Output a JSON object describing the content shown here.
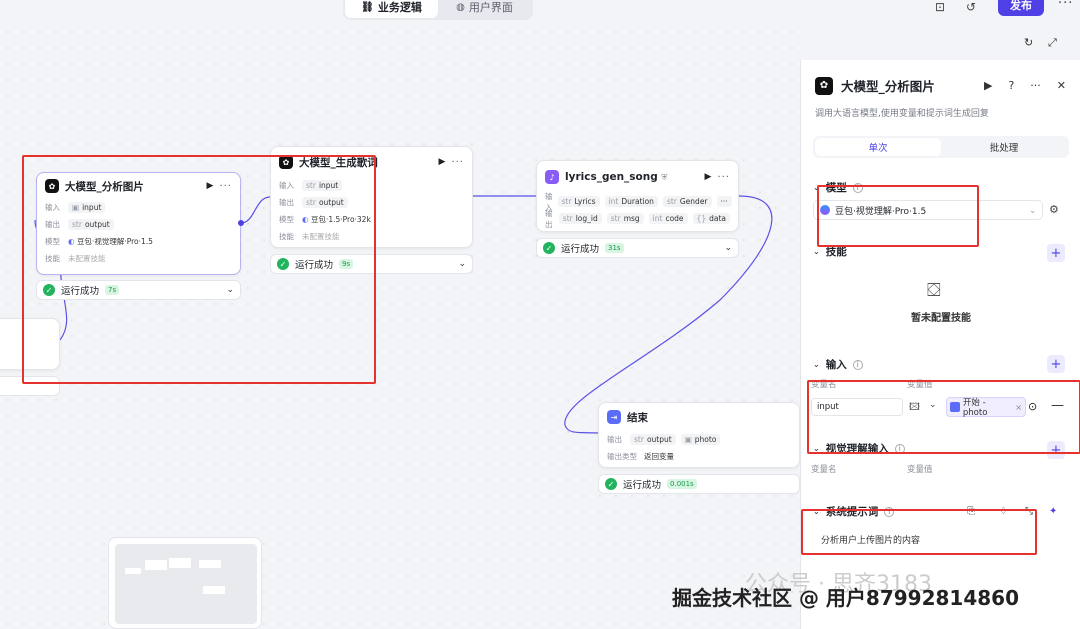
{
  "topbar": {
    "tabs": [
      {
        "label": "业务逻辑",
        "icon": "flow-icon"
      },
      {
        "label": "用户界面",
        "icon": "ui-icon"
      }
    ],
    "publish_label": "发布"
  },
  "nodes": {
    "analyze": {
      "title": "大模型_分析图片",
      "input_label": "输入",
      "input_var": "input",
      "output_label": "输出",
      "output_type": "str",
      "output_var": "output",
      "model_label": "模型",
      "model_name": "豆包·视觉理解·Pro·1.5",
      "skill_label": "技能",
      "skill_value": "未配置技能",
      "status_label": "运行成功",
      "status_time": "7s"
    },
    "lyrics": {
      "title": "大模型_生成歌词",
      "input_label": "输入",
      "input_type": "str",
      "input_var": "input",
      "output_label": "输出",
      "output_type": "str",
      "output_var": "output",
      "model_label": "模型",
      "model_name": "豆包·1.5·Pro·32k",
      "skill_label": "技能",
      "skill_value": "未配置技能",
      "status_label": "运行成功",
      "status_time": "9s"
    },
    "song": {
      "title": "lyrics_gen_song",
      "input_label": "输入",
      "inputs": [
        {
          "type": "str",
          "name": "Lyrics"
        },
        {
          "type": "int",
          "name": "Duration"
        },
        {
          "type": "str",
          "name": "Gender"
        }
      ],
      "output_label": "输出",
      "outputs": [
        {
          "type": "str",
          "name": "log_id"
        },
        {
          "type": "str",
          "name": "msg"
        },
        {
          "type": "int",
          "name": "code"
        },
        {
          "type": "{}",
          "name": "data"
        }
      ],
      "status_label": "运行成功",
      "status_time": "31s"
    },
    "end": {
      "title": "结束",
      "output_label": "输出",
      "outputs": [
        {
          "type": "str",
          "name": "output"
        },
        {
          "type": "img",
          "name": "photo"
        }
      ],
      "output_type_label": "输出类型",
      "output_type_value": "返回变量",
      "status_label": "运行成功",
      "status_time": "0.001s"
    }
  },
  "panel": {
    "title": "大模型_分析图片",
    "description": "调用大语言模型,使用变量和提示词生成回复",
    "tabs": [
      "单次",
      "批处理"
    ],
    "model_section": "模型",
    "model_value": "豆包·视觉理解·Pro·1.5",
    "skill_section": "技能",
    "skill_empty": "暂未配置技能",
    "input_section": "输入",
    "col_var_name": "变量名",
    "col_var_value": "变量值",
    "input_var_name": "input",
    "input_ref": "开始 - photo",
    "visual_section": "视觉理解输入",
    "prompt_section": "系统提示词",
    "prompt_text": "分析用户上传图片的内容"
  },
  "watermark": "掘金技术社区 @ 用户87992814860",
  "watermark_bg": "公众号 · 思齐3183",
  "colors": {
    "accent": "#4e40e5",
    "success": "#22b35e",
    "highlight": "#e5322e"
  }
}
